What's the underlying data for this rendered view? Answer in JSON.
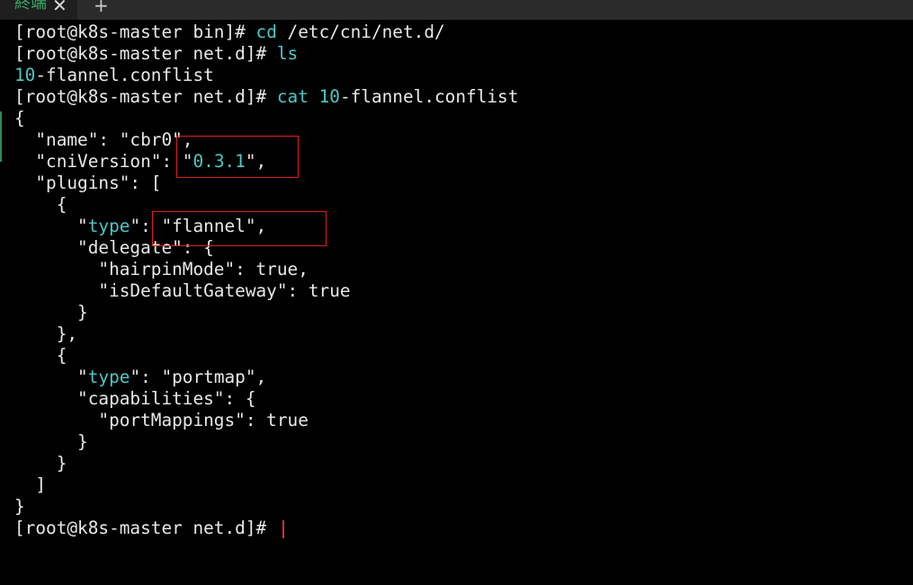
{
  "tab": {
    "label": "終端",
    "close_glyph": "✕",
    "new_glyph": "+"
  },
  "terminal": {
    "lines": [
      {
        "prompt": "[root@k8s-master bin]# ",
        "cmd": "cd",
        "rest": " /etc/cni/net.d/"
      },
      {
        "prompt": "[root@k8s-master net.d]# ",
        "cmd": "ls",
        "rest": ""
      },
      {
        "out_a": "10",
        "out_b": "-flannel.conflist"
      },
      {
        "prompt": "[root@k8s-master net.d]# ",
        "cmd": "cat",
        "sp": " ",
        "arg_a": "10",
        "arg_b": "-flannel.conflist"
      },
      {
        "text": "{"
      },
      {
        "text": "  \"name\": \"cbr0\","
      },
      {
        "pre": "  \"cniVersion\": ",
        "q1": "\"",
        "val": "0.3.1",
        "q2": "\"",
        "post": ","
      },
      {
        "text": "  \"plugins\": ["
      },
      {
        "text": "    {"
      },
      {
        "pre": "      \"",
        "key": "type",
        "post": "\": \"flannel\","
      },
      {
        "text": "      \"delegate\": {"
      },
      {
        "text": "        \"hairpinMode\": true,"
      },
      {
        "text": "        \"isDefaultGateway\": true"
      },
      {
        "text": "      }"
      },
      {
        "text": "    },"
      },
      {
        "text": "    {"
      },
      {
        "pre": "      \"",
        "key": "type",
        "post": "\": \"portmap\","
      },
      {
        "text": "      \"capabilities\": {"
      },
      {
        "text": "        \"portMappings\": true"
      },
      {
        "text": "      }"
      },
      {
        "text": "    }"
      },
      {
        "text": "  ]"
      },
      {
        "text": "}"
      },
      {
        "prompt": "[root@k8s-master net.d]# "
      }
    ]
  },
  "colors": {
    "background": "#000000",
    "text": "#e8e8e8",
    "command": "#4cc8c6",
    "annotation_box": "#e51c1c",
    "cursor": "#e03030",
    "tab_label": "#35b06a"
  }
}
